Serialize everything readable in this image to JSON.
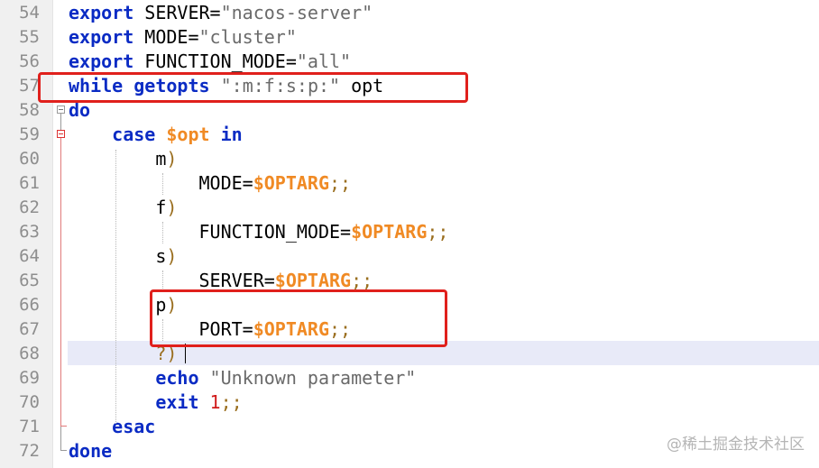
{
  "editor": {
    "lines": [
      {
        "number": "54",
        "tokens": [
          {
            "t": "kw",
            "v": "export"
          },
          {
            "t": "plain",
            "v": " SERVER="
          },
          {
            "t": "str",
            "v": "\"nacos-server\""
          }
        ]
      },
      {
        "number": "55",
        "tokens": [
          {
            "t": "kw",
            "v": "export"
          },
          {
            "t": "plain",
            "v": " MODE="
          },
          {
            "t": "str",
            "v": "\"cluster\""
          }
        ]
      },
      {
        "number": "56",
        "tokens": [
          {
            "t": "kw",
            "v": "export"
          },
          {
            "t": "plain",
            "v": " FUNCTION_MODE="
          },
          {
            "t": "str",
            "v": "\"all\""
          }
        ]
      },
      {
        "number": "57",
        "tokens": [
          {
            "t": "kw",
            "v": "while"
          },
          {
            "t": "plain",
            "v": " "
          },
          {
            "t": "kw",
            "v": "getopts"
          },
          {
            "t": "plain",
            "v": " "
          },
          {
            "t": "str",
            "v": "\":m:f:s:p:\""
          },
          {
            "t": "plain",
            "v": " opt"
          }
        ]
      },
      {
        "number": "58",
        "tokens": [
          {
            "t": "kw",
            "v": "do"
          }
        ]
      },
      {
        "number": "59",
        "tokens": [
          {
            "t": "plain",
            "v": "    "
          },
          {
            "t": "kw",
            "v": "case"
          },
          {
            "t": "plain",
            "v": " "
          },
          {
            "t": "var",
            "v": "$opt"
          },
          {
            "t": "plain",
            "v": " "
          },
          {
            "t": "kw",
            "v": "in"
          }
        ]
      },
      {
        "number": "60",
        "tokens": [
          {
            "t": "plain",
            "v": "        m"
          },
          {
            "t": "op",
            "v": ")"
          }
        ]
      },
      {
        "number": "61",
        "tokens": [
          {
            "t": "plain",
            "v": "            MODE="
          },
          {
            "t": "var",
            "v": "$OPTARG"
          },
          {
            "t": "op",
            "v": ";;"
          }
        ]
      },
      {
        "number": "62",
        "tokens": [
          {
            "t": "plain",
            "v": "        f"
          },
          {
            "t": "op",
            "v": ")"
          }
        ]
      },
      {
        "number": "63",
        "tokens": [
          {
            "t": "plain",
            "v": "            FUNCTION_MODE="
          },
          {
            "t": "var",
            "v": "$OPTARG"
          },
          {
            "t": "op",
            "v": ";;"
          }
        ]
      },
      {
        "number": "64",
        "tokens": [
          {
            "t": "plain",
            "v": "        s"
          },
          {
            "t": "op",
            "v": ")"
          }
        ]
      },
      {
        "number": "65",
        "tokens": [
          {
            "t": "plain",
            "v": "            SERVER="
          },
          {
            "t": "var",
            "v": "$OPTARG"
          },
          {
            "t": "op",
            "v": ";;"
          }
        ]
      },
      {
        "number": "66",
        "tokens": [
          {
            "t": "plain",
            "v": "        p"
          },
          {
            "t": "op",
            "v": ")"
          }
        ]
      },
      {
        "number": "67",
        "tokens": [
          {
            "t": "plain",
            "v": "            PORT="
          },
          {
            "t": "var",
            "v": "$OPTARG"
          },
          {
            "t": "op",
            "v": ";;"
          }
        ]
      },
      {
        "number": "68",
        "tokens": [
          {
            "t": "plain",
            "v": "        "
          },
          {
            "t": "op",
            "v": "?)"
          }
        ]
      },
      {
        "number": "69",
        "tokens": [
          {
            "t": "plain",
            "v": "        "
          },
          {
            "t": "kw",
            "v": "echo"
          },
          {
            "t": "plain",
            "v": " "
          },
          {
            "t": "str",
            "v": "\"Unknown parameter\""
          }
        ]
      },
      {
        "number": "70",
        "tokens": [
          {
            "t": "plain",
            "v": "        "
          },
          {
            "t": "kw",
            "v": "exit"
          },
          {
            "t": "plain",
            "v": " "
          },
          {
            "t": "num",
            "v": "1"
          },
          {
            "t": "op",
            "v": ";;"
          }
        ]
      },
      {
        "number": "71",
        "tokens": [
          {
            "t": "plain",
            "v": "    "
          },
          {
            "t": "kw",
            "v": "esac"
          }
        ]
      },
      {
        "number": "72",
        "tokens": [
          {
            "t": "kw",
            "v": "done"
          }
        ]
      }
    ]
  },
  "colors": {
    "keyword": "#0a2bc4",
    "string": "#6a6a6a",
    "variable": "#f08a24",
    "number": "#d11a1a",
    "annotation": "#e0201c",
    "current_line": "#e8eaf8"
  },
  "icons": [
    "fold-marker-icon",
    "fold-end-icon"
  ],
  "watermark": "@稀土掘金技术社区"
}
